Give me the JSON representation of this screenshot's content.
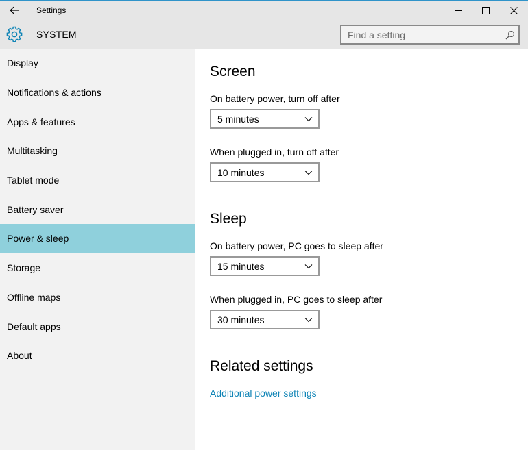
{
  "window": {
    "title": "Settings",
    "back_icon": "arrow-left-icon",
    "minimize_icon": "minimize-icon",
    "maximize_icon": "maximize-icon",
    "close_icon": "close-icon"
  },
  "header": {
    "icon": "gear-icon",
    "title": "SYSTEM",
    "search_placeholder": "Find a setting",
    "search_icon": "search-icon"
  },
  "sidebar": {
    "items": [
      {
        "label": "Display",
        "active": false
      },
      {
        "label": "Notifications & actions",
        "active": false
      },
      {
        "label": "Apps & features",
        "active": false
      },
      {
        "label": "Multitasking",
        "active": false
      },
      {
        "label": "Tablet mode",
        "active": false
      },
      {
        "label": "Battery saver",
        "active": false
      },
      {
        "label": "Power & sleep",
        "active": true
      },
      {
        "label": "Storage",
        "active": false
      },
      {
        "label": "Offline maps",
        "active": false
      },
      {
        "label": "Default apps",
        "active": false
      },
      {
        "label": "About",
        "active": false
      }
    ],
    "active_color": "#8fd0dc"
  },
  "screen": {
    "title": "Screen",
    "battery_label": "On battery power, turn off after",
    "battery_value": "5 minutes",
    "plugged_label": "When plugged in, turn off after",
    "plugged_value": "10 minutes"
  },
  "sleep": {
    "title": "Sleep",
    "battery_label": "On battery power, PC goes to sleep after",
    "battery_value": "15 minutes",
    "plugged_label": "When plugged in, PC goes to sleep after",
    "plugged_value": "30 minutes"
  },
  "related": {
    "title": "Related settings",
    "link": "Additional power settings",
    "link_color": "#0f84b6"
  }
}
